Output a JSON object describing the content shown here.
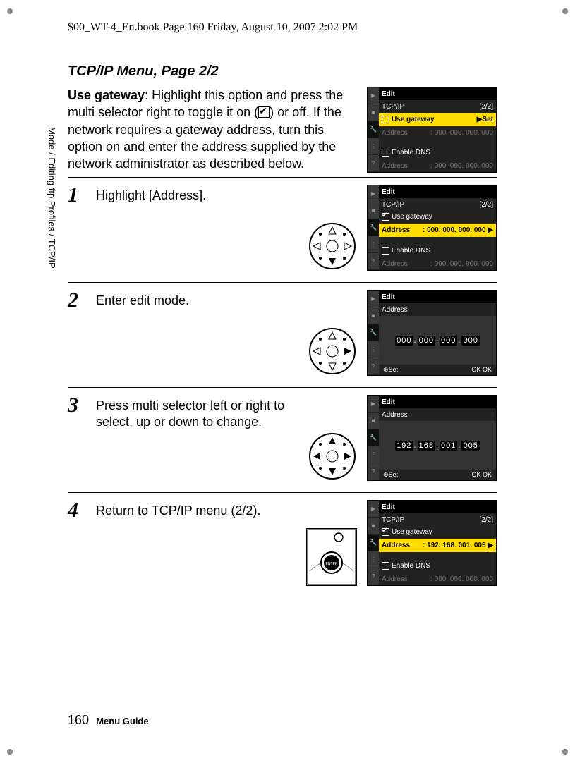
{
  "header": "$00_WT-4_En.book  Page 160  Friday, August 10, 2007  2:02 PM",
  "title": "TCP/IP Menu, Page 2/2",
  "intro": {
    "lead": "Use gateway",
    "body_a": ": Highlight this option and press the multi selector right to toggle it on (",
    "body_b": ") or off.  If the network requires a gateway address, turn this option on and enter the address supplied by the network administrator as described below."
  },
  "steps": [
    {
      "num": "1",
      "text": "Highlight [Address]."
    },
    {
      "num": "2",
      "text": "Enter edit mode."
    },
    {
      "num": "3",
      "text": "Press multi selector left or right to select, up or down to change."
    },
    {
      "num": "4",
      "text": "Return to TCP/IP menu (2/2)."
    }
  ],
  "side_label": "Mode / Editing ftp Profiles / TCP/IP",
  "footer": {
    "page": "160",
    "guide": "Menu Guide"
  },
  "screens": {
    "s0": {
      "edit": "Edit",
      "tcpip": "TCP/IP",
      "page": "[2/2]",
      "use_gw": "Use gateway",
      "set": "▶Set",
      "addr_l": "Address",
      "addr_v": ": 000. 000. 000. 000",
      "dns": "Enable DNS",
      "addr2_l": "Address",
      "addr2_v": ": 000. 000. 000. 000"
    },
    "s1": {
      "edit": "Edit",
      "tcpip": "TCP/IP",
      "page": "[2/2]",
      "use_gw": "Use gateway",
      "addr_l": "Address",
      "addr_v": ": 000. 000. 000. 000",
      "dns": "Enable DNS",
      "addr2_l": "Address",
      "addr2_v": ": 000. 000. 000. 000"
    },
    "s2": {
      "edit": "Edit",
      "addr": "Address",
      "octets": [
        "000",
        "000",
        "000",
        "000"
      ],
      "set": "Set",
      "ok": "OK"
    },
    "s3": {
      "edit": "Edit",
      "addr": "Address",
      "octets": [
        "192",
        "168",
        "001",
        "005"
      ],
      "set": "Set",
      "ok": "OK"
    },
    "s4": {
      "edit": "Edit",
      "tcpip": "TCP/IP",
      "page": "[2/2]",
      "use_gw": "Use gateway",
      "addr_l": "Address",
      "addr_v": ": 192. 168. 001. 005",
      "dns": "Enable DNS",
      "addr2_l": "Address",
      "addr2_v": ": 000. 000. 000. 000"
    }
  }
}
